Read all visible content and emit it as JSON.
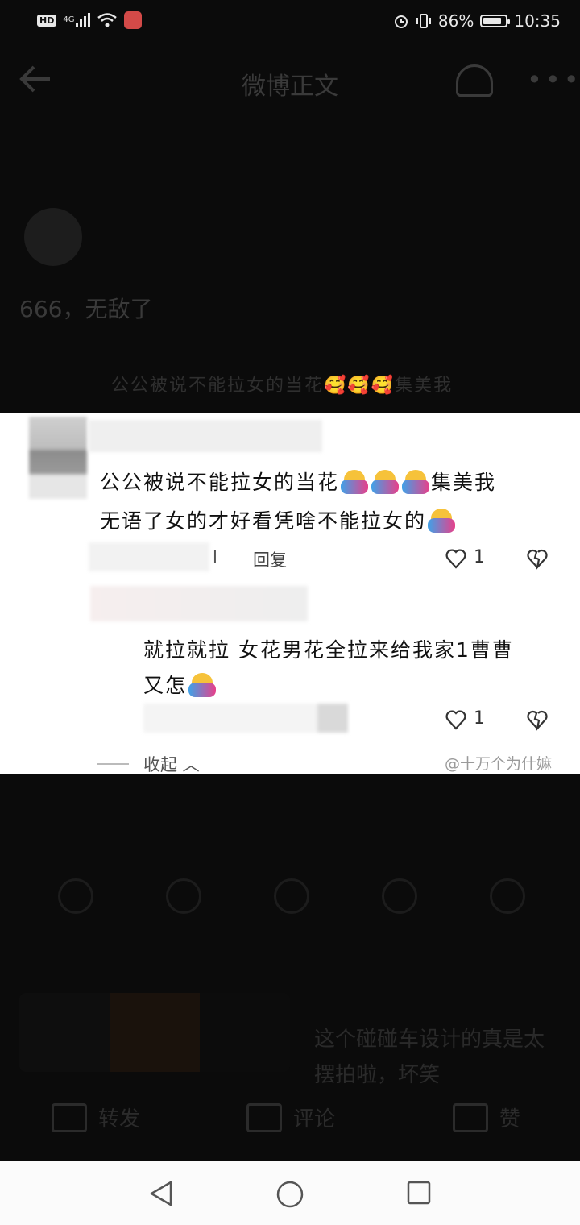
{
  "status_bar": {
    "hd": "HD",
    "network": "4G",
    "battery": "86%",
    "battery_level": 0.86,
    "time": "10:35"
  },
  "nav": {
    "title": "微博正文"
  },
  "post": {
    "post_text": "666，无敌了",
    "quote_text": "公公被说不能拉女的当花🥰🥰🥰集美我"
  },
  "comment_image": {
    "comment1_line1": "公公被说不能拉女的当花",
    "comment1_line1_end": "集美我",
    "comment1_line2": "无语了女的才好看凭啥不能拉女的",
    "reply_mark": "I",
    "reply_label": "回复",
    "comment1_likes": "1",
    "comment2_line1": "就拉就拉 女花男花全拉来给我家1曹曹",
    "comment2_line2": "又怎",
    "comment2_likes": "1",
    "collapse_label": "收起",
    "watermark": "@十万个为什嫲"
  },
  "related": {
    "ad_text": "这个碰碰车设计的真是太摆拍啦，坏笑"
  },
  "actions": {
    "forward": "转发",
    "comment": "评论",
    "like": "赞"
  },
  "icons": {
    "back": "back-arrow-icon",
    "listen": "headphones-icon",
    "more": "more-icon",
    "heart": "heart-icon",
    "dislike": "broken-heart-icon",
    "nav_back": "triangle-back-icon",
    "nav_home": "circle-home-icon",
    "nav_recent": "square-recent-icon"
  },
  "colors": {
    "background": "#0b0b0b",
    "panel": "#ffffff",
    "nav_bar": "#fbfbfb"
  }
}
